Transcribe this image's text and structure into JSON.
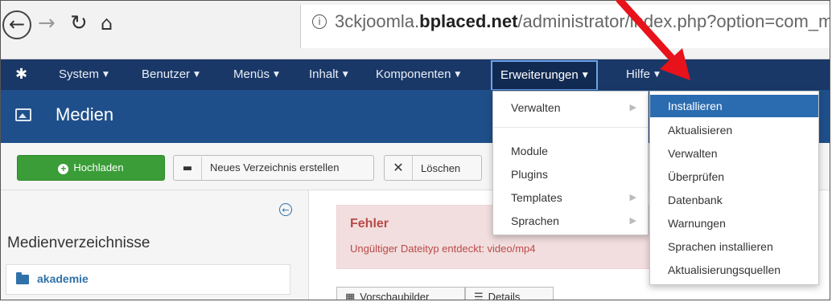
{
  "browser": {
    "url_prefix": "3ckjoomla.",
    "url_domain": "bplaced.net",
    "url_suffix": "/administrator/index.php?option=com_me"
  },
  "nav": {
    "items": [
      {
        "label": "System"
      },
      {
        "label": "Benutzer"
      },
      {
        "label": "Menüs"
      },
      {
        "label": "Inhalt"
      },
      {
        "label": "Komponenten"
      },
      {
        "label": "Erweiterungen"
      },
      {
        "label": "Hilfe"
      }
    ]
  },
  "title": "Medien",
  "toolbar": {
    "upload": "Hochladen",
    "new_folder": "Neues Verzeichnis erstellen",
    "delete": "Löschen"
  },
  "sidebar": {
    "title": "Medienverzeichnisse",
    "folder": "akademie"
  },
  "alert": {
    "title": "Fehler",
    "message": "Ungültiger Dateityp entdeckt: video/mp4"
  },
  "view_buttons": {
    "thumbnails": "Vorschaubilder",
    "details": "Details"
  },
  "extensions_menu": {
    "items": [
      {
        "label": "Verwalten",
        "submenu": true
      },
      {
        "label": "Module",
        "submenu": false
      },
      {
        "label": "Plugins",
        "submenu": false
      },
      {
        "label": "Templates",
        "submenu": true
      },
      {
        "label": "Sprachen",
        "submenu": true
      }
    ]
  },
  "manage_submenu": {
    "items": [
      {
        "label": "Installieren",
        "highlighted": true
      },
      {
        "label": "Aktualisieren"
      },
      {
        "label": "Verwalten"
      },
      {
        "label": "Überprüfen"
      },
      {
        "label": "Datenbank"
      },
      {
        "label": "Warnungen"
      },
      {
        "label": "Sprachen installieren"
      },
      {
        "label": "Aktualisierungsquellen"
      }
    ]
  },
  "colors": {
    "nav_bg": "#1a3867",
    "title_bg": "#1f4f8a",
    "upload_btn": "#3a9d37",
    "menu_highlight": "#2b6cb0",
    "alert_text": "#b94a48",
    "annotation_arrow": "#e8121a"
  }
}
